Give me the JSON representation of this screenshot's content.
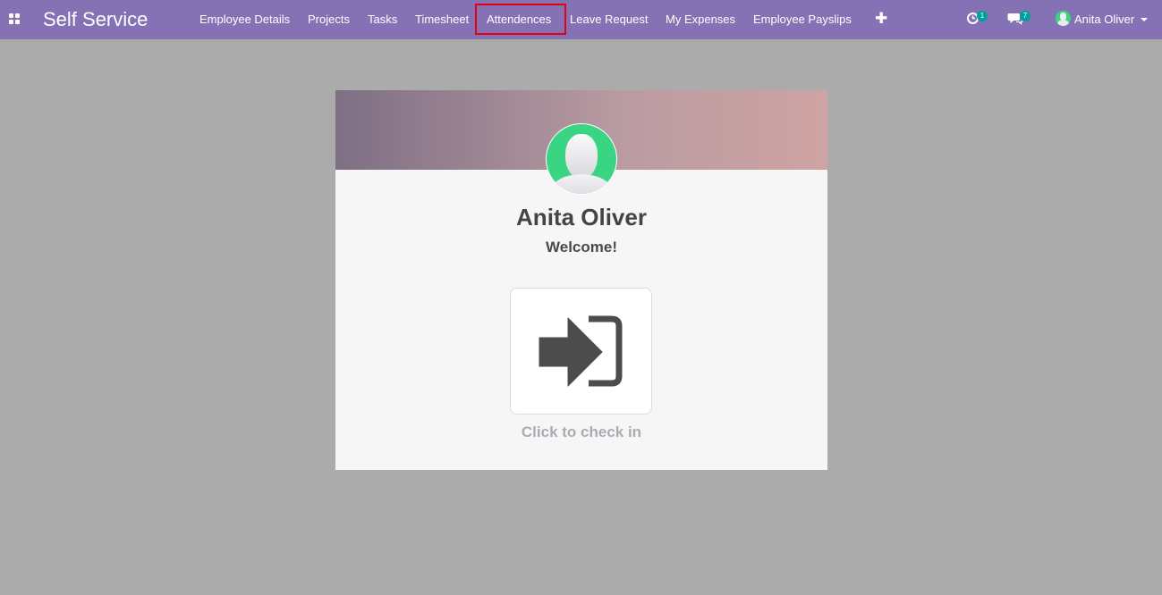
{
  "app": {
    "title": "Self Service"
  },
  "nav": {
    "items": [
      {
        "label": "Employee Details"
      },
      {
        "label": "Projects"
      },
      {
        "label": "Tasks"
      },
      {
        "label": "Timesheet"
      },
      {
        "label": "Attendences",
        "highlighted": true
      },
      {
        "label": "Leave Request"
      },
      {
        "label": "My Expenses"
      },
      {
        "label": "Employee Payslips"
      }
    ],
    "add_icon": "plus-icon"
  },
  "systray": {
    "activity": {
      "icon": "clock-icon",
      "count": "1"
    },
    "messages": {
      "icon": "chat-icon",
      "count": "7"
    },
    "user": {
      "name": "Anita Oliver",
      "icon": "avatar"
    }
  },
  "attendance": {
    "employee_name": "Anita Oliver",
    "greeting": "Welcome!",
    "button_icon": "sign-in-icon",
    "checkin_label": "Click to check in"
  },
  "colors": {
    "navbar": "#8572b5",
    "highlight": "#e3000f",
    "badge": "#00a09d",
    "avatar_bg": "#3ad583"
  }
}
